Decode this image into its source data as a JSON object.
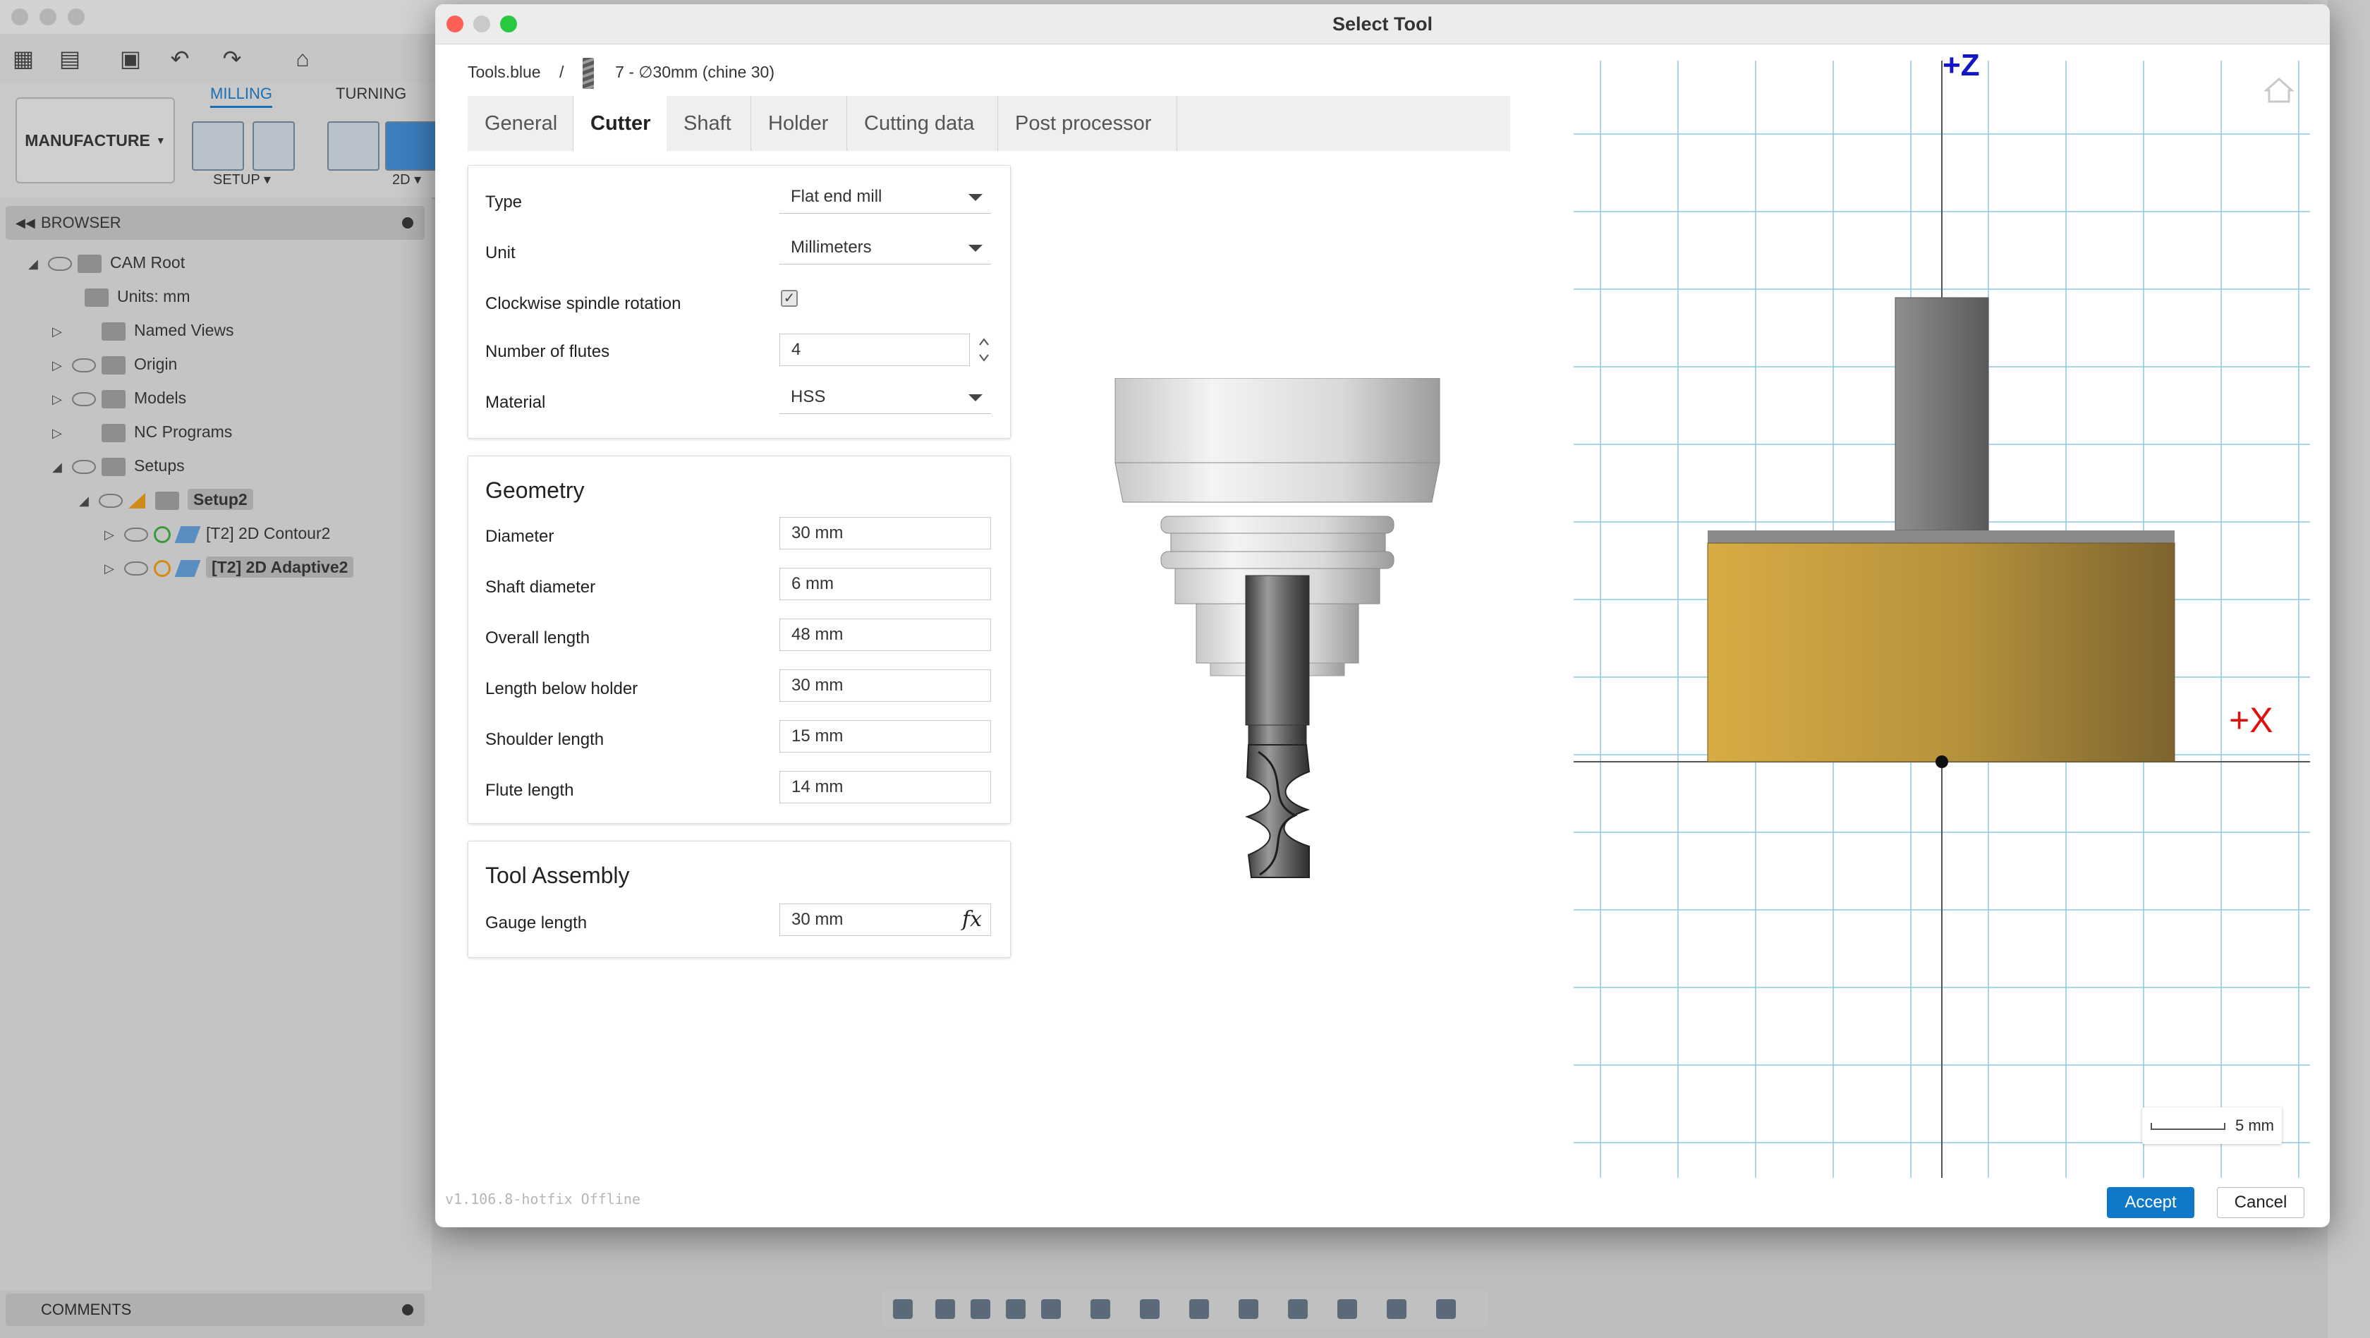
{
  "background_app": {
    "ribbon": {
      "workspace": "MANUFACTURE",
      "tabs": [
        "MILLING",
        "TURNING"
      ],
      "active_tab": "MILLING",
      "groups": [
        "SETUP",
        "2D"
      ]
    },
    "browser": {
      "title": "BROWSER",
      "items": [
        {
          "label": "CAM Root"
        },
        {
          "label": "Units: mm"
        },
        {
          "label": "Named Views"
        },
        {
          "label": "Origin"
        },
        {
          "label": "Models"
        },
        {
          "label": "NC Programs"
        },
        {
          "label": "Setups"
        },
        {
          "label": "Setup2"
        },
        {
          "label": "[T2] 2D Contour2"
        },
        {
          "label": "[T2] 2D Adaptive2"
        }
      ]
    },
    "comments_label": "COMMENTS"
  },
  "dialog": {
    "title": "Select Tool",
    "breadcrumb": {
      "library": "Tools.blue",
      "separator": "/",
      "tool": "7 - ∅30mm (chine 30)"
    },
    "tabs": [
      {
        "label": "General"
      },
      {
        "label": "Cutter"
      },
      {
        "label": "Shaft"
      },
      {
        "label": "Holder"
      },
      {
        "label": "Cutting data"
      },
      {
        "label": "Post processor"
      }
    ],
    "active_tab": "Cutter",
    "cutter": {
      "type_label": "Type",
      "type_value": "Flat end mill",
      "unit_label": "Unit",
      "unit_value": "Millimeters",
      "clockwise_label": "Clockwise spindle rotation",
      "clockwise_checked": true,
      "flutes_label": "Number of flutes",
      "flutes_value": "4",
      "material_label": "Material",
      "material_value": "HSS"
    },
    "geometry": {
      "title": "Geometry",
      "diameter_label": "Diameter",
      "diameter_value": "30 mm",
      "shaft_diameter_label": "Shaft diameter",
      "shaft_diameter_value": "6 mm",
      "overall_length_label": "Overall length",
      "overall_length_value": "48 mm",
      "length_below_holder_label": "Length below holder",
      "length_below_holder_value": "30 mm",
      "shoulder_length_label": "Shoulder length",
      "shoulder_length_value": "15 mm",
      "flute_length_label": "Flute length",
      "flute_length_value": "14 mm"
    },
    "tool_assembly": {
      "title": "Tool Assembly",
      "gauge_length_label": "Gauge length",
      "gauge_length_value": "30 mm",
      "fx_label": "fx"
    },
    "preview": {
      "z_axis_label": "+Z",
      "x_axis_label": "+X",
      "scale_label": "5 mm",
      "cutter_color": "#c9a23c",
      "grid_color": "#8cc8e6"
    },
    "version": "v1.106.8-hotfix Offline",
    "accept_label": "Accept",
    "cancel_label": "Cancel",
    "accent_color": "#0f78c8"
  }
}
